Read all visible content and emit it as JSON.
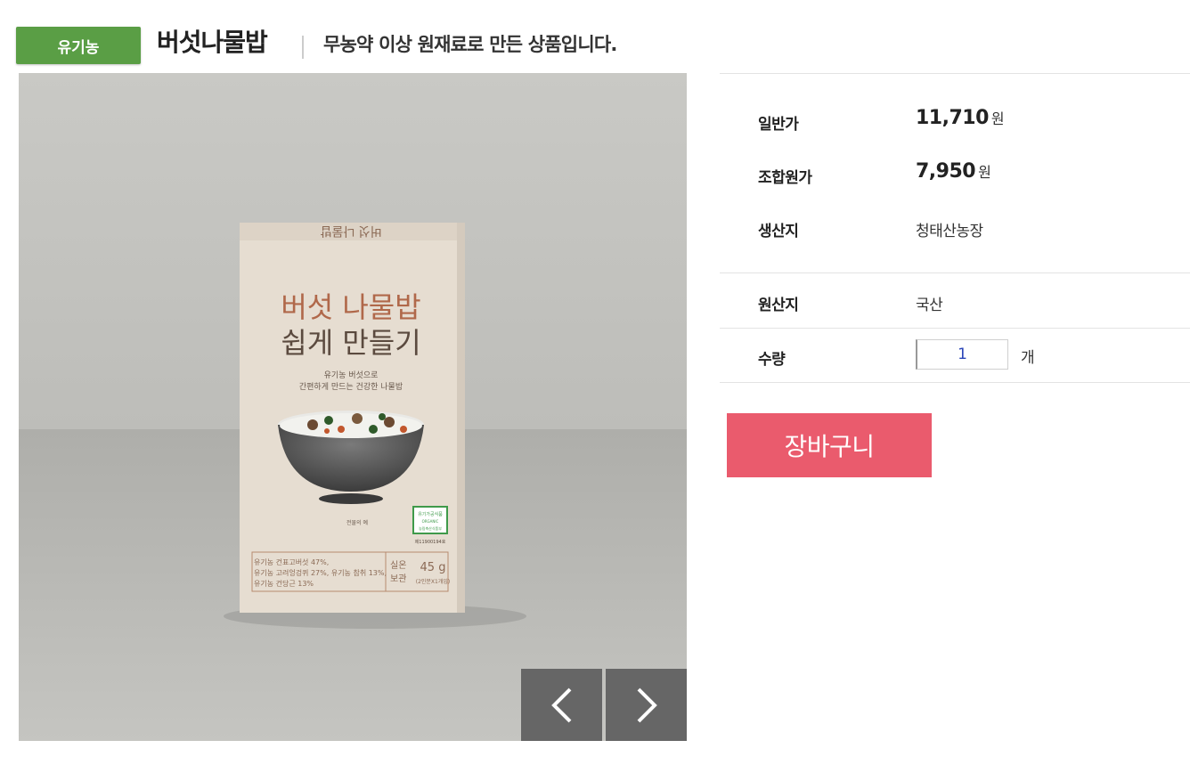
{
  "header": {
    "badge": "유기농",
    "title": "버섯나물밥",
    "subtitle": "무농약 이상 원재료로 만든 상품입니다."
  },
  "product_image": {
    "box_title_line1": "버섯 나물밥",
    "box_title_line2": "쉽게 만들기",
    "box_top_flipped": "버섯 나물밥",
    "box_desc_line1": "유기농 버섯으로",
    "box_desc_line2": "간편하게 만드는 건강한 나물밥",
    "box_serving": "전물의 예",
    "box_cert_text": "유기가공식품",
    "box_cert_sub": "ORGANIC",
    "box_cert_org": "농림축산식품부",
    "box_cert_no": "제11900194호",
    "box_ing1": "유기농 건표고버섯 47%,",
    "box_ing2": "유기농 고려엉겅퀴 27%, 유기농 참취 13%,",
    "box_ing3": "유기농 건당근 13%",
    "box_storage1": "실온",
    "box_storage2": "보관",
    "box_weight": "45 g",
    "box_weight_sub": "(2인분X1개입)"
  },
  "gallery_nav": {
    "prev_icon": "chevron-left-icon",
    "next_icon": "chevron-right-icon"
  },
  "info": {
    "regular_price_label": "일반가",
    "regular_price": "11,710",
    "member_price_label": "조합원가",
    "member_price": "7,950",
    "currency": "원",
    "producer_label": "생산지",
    "producer": "청태산농장",
    "origin_label": "원산지",
    "origin": "국산",
    "quantity_label": "수량",
    "quantity": "1",
    "quantity_unit": "개",
    "cart_button": "장바구니"
  },
  "colors": {
    "badge": "#5a9e45",
    "cart": "#ea5b6d",
    "nav": "#666666"
  }
}
